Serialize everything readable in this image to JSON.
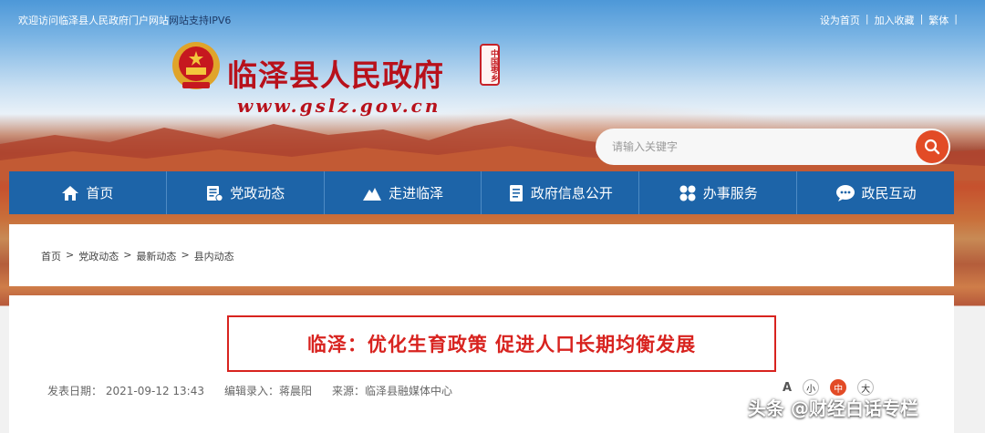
{
  "topbar": {
    "welcome": "欢迎访问临泽县人民政府门户网站",
    "ipv6": "网站支持IPV6",
    "links": [
      "设为首页",
      "加入收藏",
      "繁体"
    ]
  },
  "header": {
    "title": "临泽县人民政府",
    "seal_text": "中国枣乡",
    "domain": "www.gslz.gov.cn"
  },
  "search": {
    "placeholder": "请输入关键字"
  },
  "nav": {
    "items": [
      {
        "label": "首页",
        "icon": "home-icon"
      },
      {
        "label": "党政动态",
        "icon": "news-icon"
      },
      {
        "label": "走进临泽",
        "icon": "mountain-icon"
      },
      {
        "label": "政府信息公开",
        "icon": "document-icon"
      },
      {
        "label": "办事服务",
        "icon": "grid-icon"
      },
      {
        "label": "政民互动",
        "icon": "chat-icon"
      }
    ]
  },
  "breadcrumb": {
    "items": [
      "首页",
      "党政动态",
      "最新动态",
      "县内动态"
    ],
    "separator": ">"
  },
  "article": {
    "title": "临泽：优化生育政策  促进人口长期均衡发展",
    "publish_label": "发表日期：",
    "publish_date": "2021-09-12 13:43",
    "editor_label": "编辑录入：",
    "editor": "蒋晨阳",
    "source_label": "来源：",
    "source": "临泽县融媒体中心"
  },
  "font_size": {
    "aa": "A",
    "small": "小",
    "medium": "中",
    "large": "大"
  },
  "watermark": "头条 @财经白话专栏",
  "colors": {
    "nav_bg": "#1d64a8",
    "title_red": "#b8111b",
    "headline_red": "#d8231f",
    "search_btn": "#e24b26"
  }
}
